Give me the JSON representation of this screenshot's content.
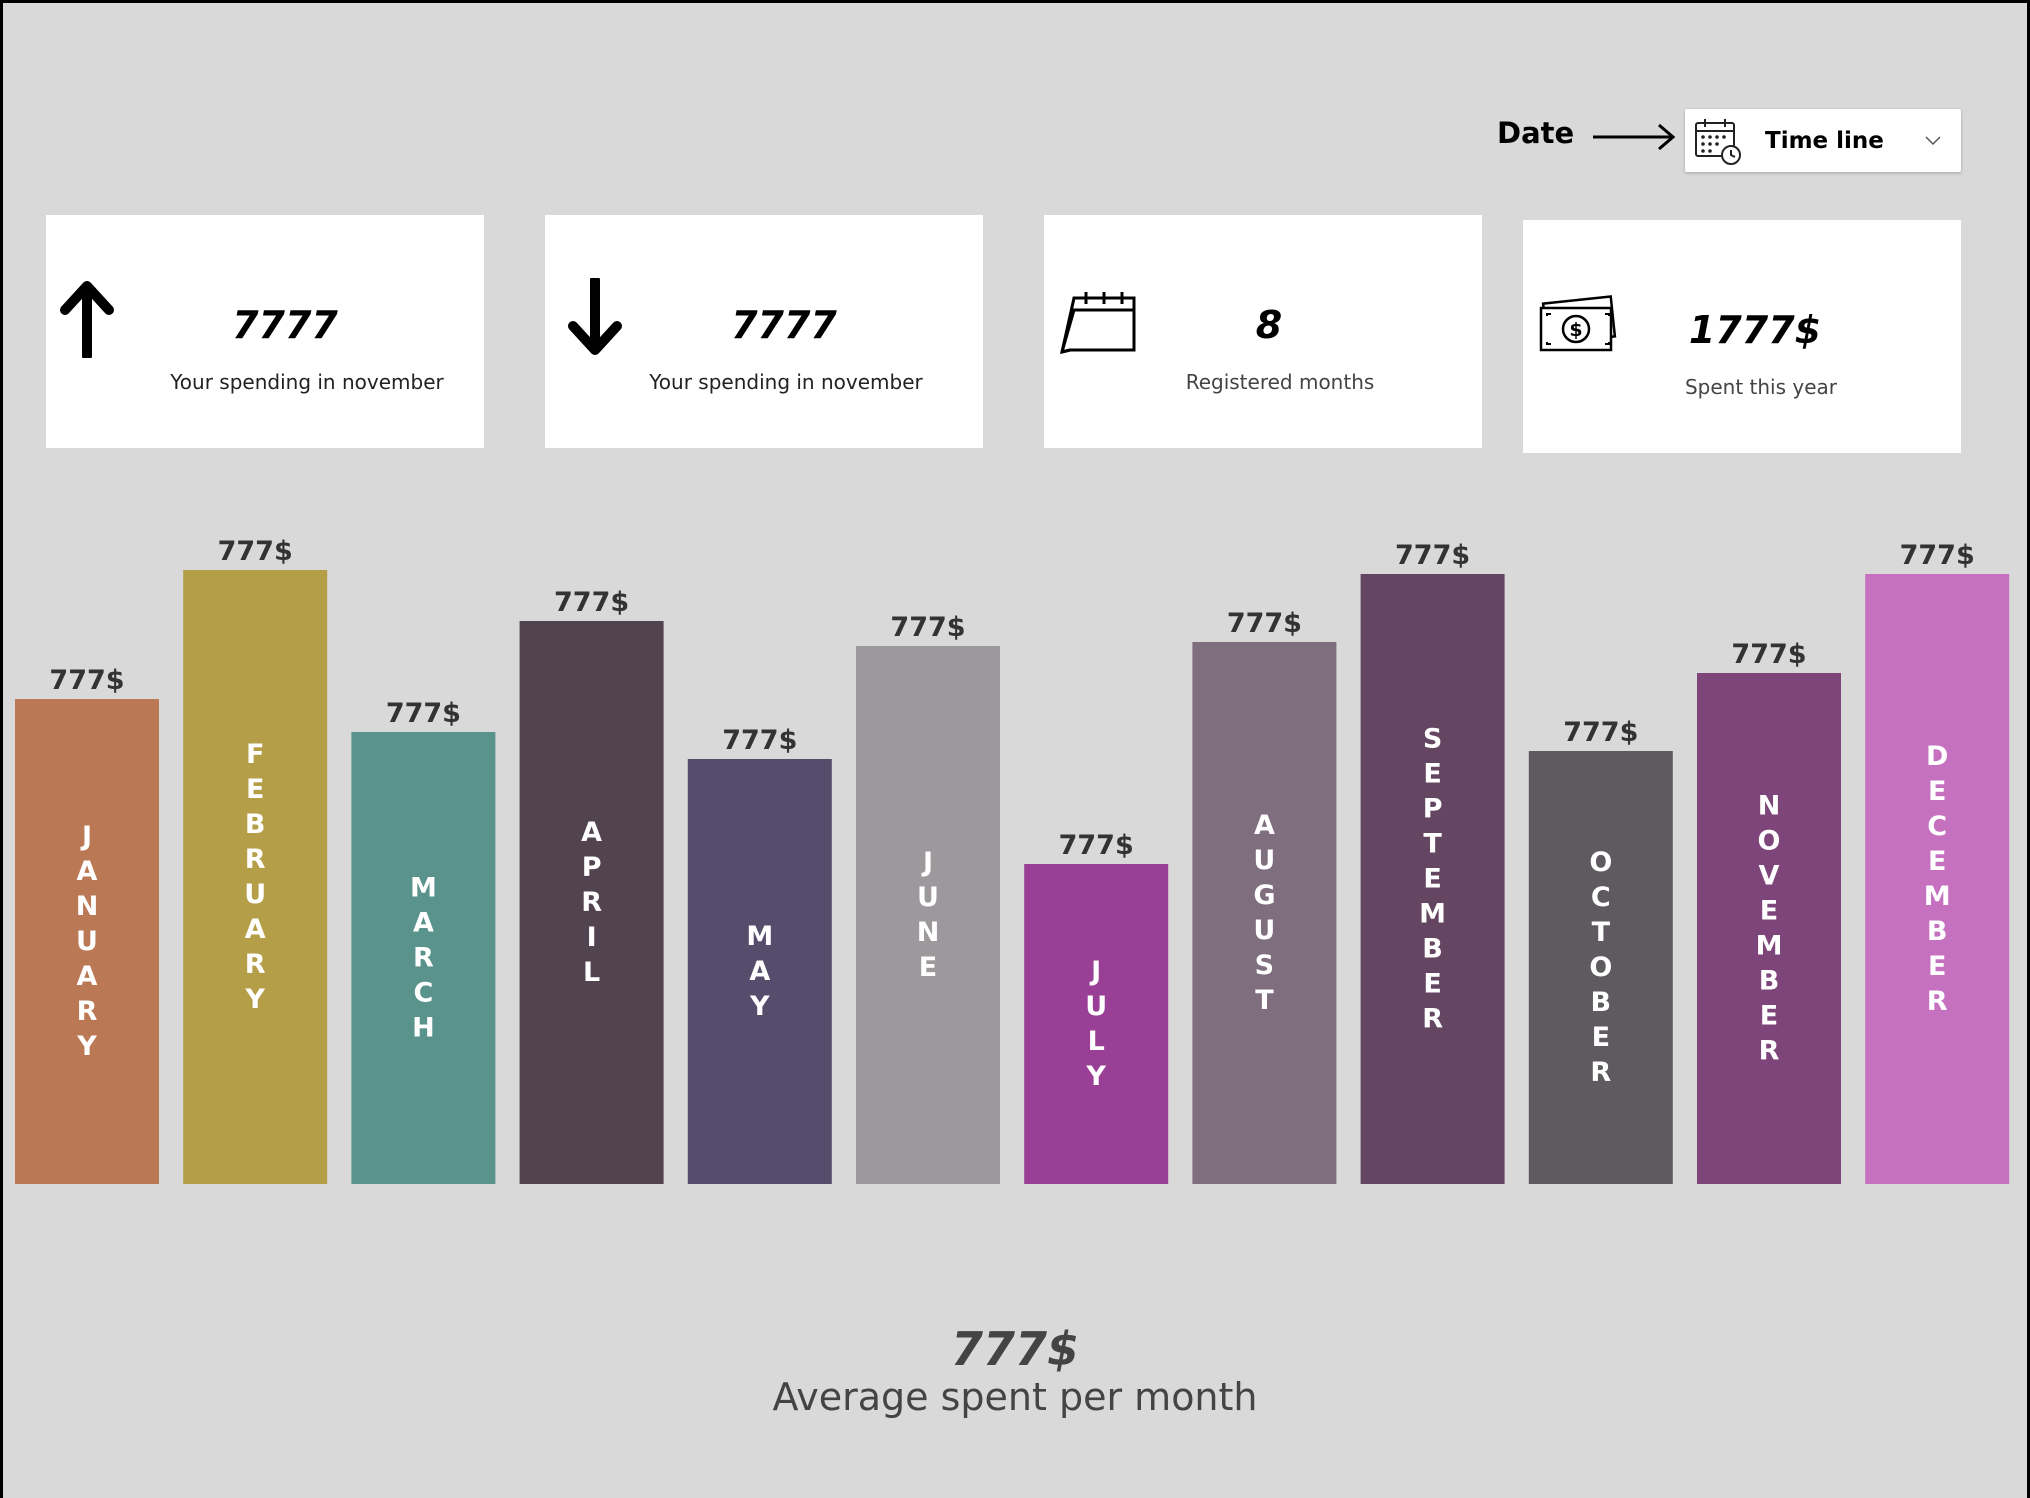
{
  "header": {
    "date_label": "Date",
    "timeline_label": "Time line",
    "timeline_icon": "calendar-clock-icon",
    "chevron_icon": "chevron-down-icon"
  },
  "cards": [
    {
      "icon": "arrow-up-icon",
      "value": "7777",
      "caption": "Your spending in november"
    },
    {
      "icon": "arrow-down-icon",
      "value": "7777",
      "caption": "Your spending in november"
    },
    {
      "icon": "calendar-icon",
      "value": "8",
      "caption": "Registered months"
    },
    {
      "icon": "money-icon",
      "value": "1777$",
      "caption": "Spent this year"
    }
  ],
  "chart_data": {
    "type": "bar",
    "categories": [
      "JANUARY",
      "FEBRUARY",
      "MARCH",
      "APRIL",
      "MAY",
      "JUNE",
      "JULY",
      "AUGUST",
      "SEPTEMBER",
      "OCTOBER",
      "NOVEMBER",
      "DECEMBER"
    ],
    "values": [
      485,
      614,
      452,
      563,
      425,
      538,
      320,
      542,
      610,
      433,
      511,
      610
    ],
    "value_labels": [
      "777$",
      "777$",
      "777$",
      "777$",
      "777$",
      "777$",
      "777$",
      "777$",
      "777$",
      "777$",
      "777$",
      "777$"
    ],
    "colors": [
      "#bb7854",
      "#b59e48",
      "#59938b",
      "#51434f",
      "#564c6c",
      "#9c989c",
      "#9a3f96",
      "#7e6e7e",
      "#654662",
      "#5f5a60",
      "#7d4579",
      "#c571c0"
    ],
    "ylim": [
      0,
      620
    ]
  },
  "summary": {
    "value": "777$",
    "caption": "Average spent per month"
  }
}
